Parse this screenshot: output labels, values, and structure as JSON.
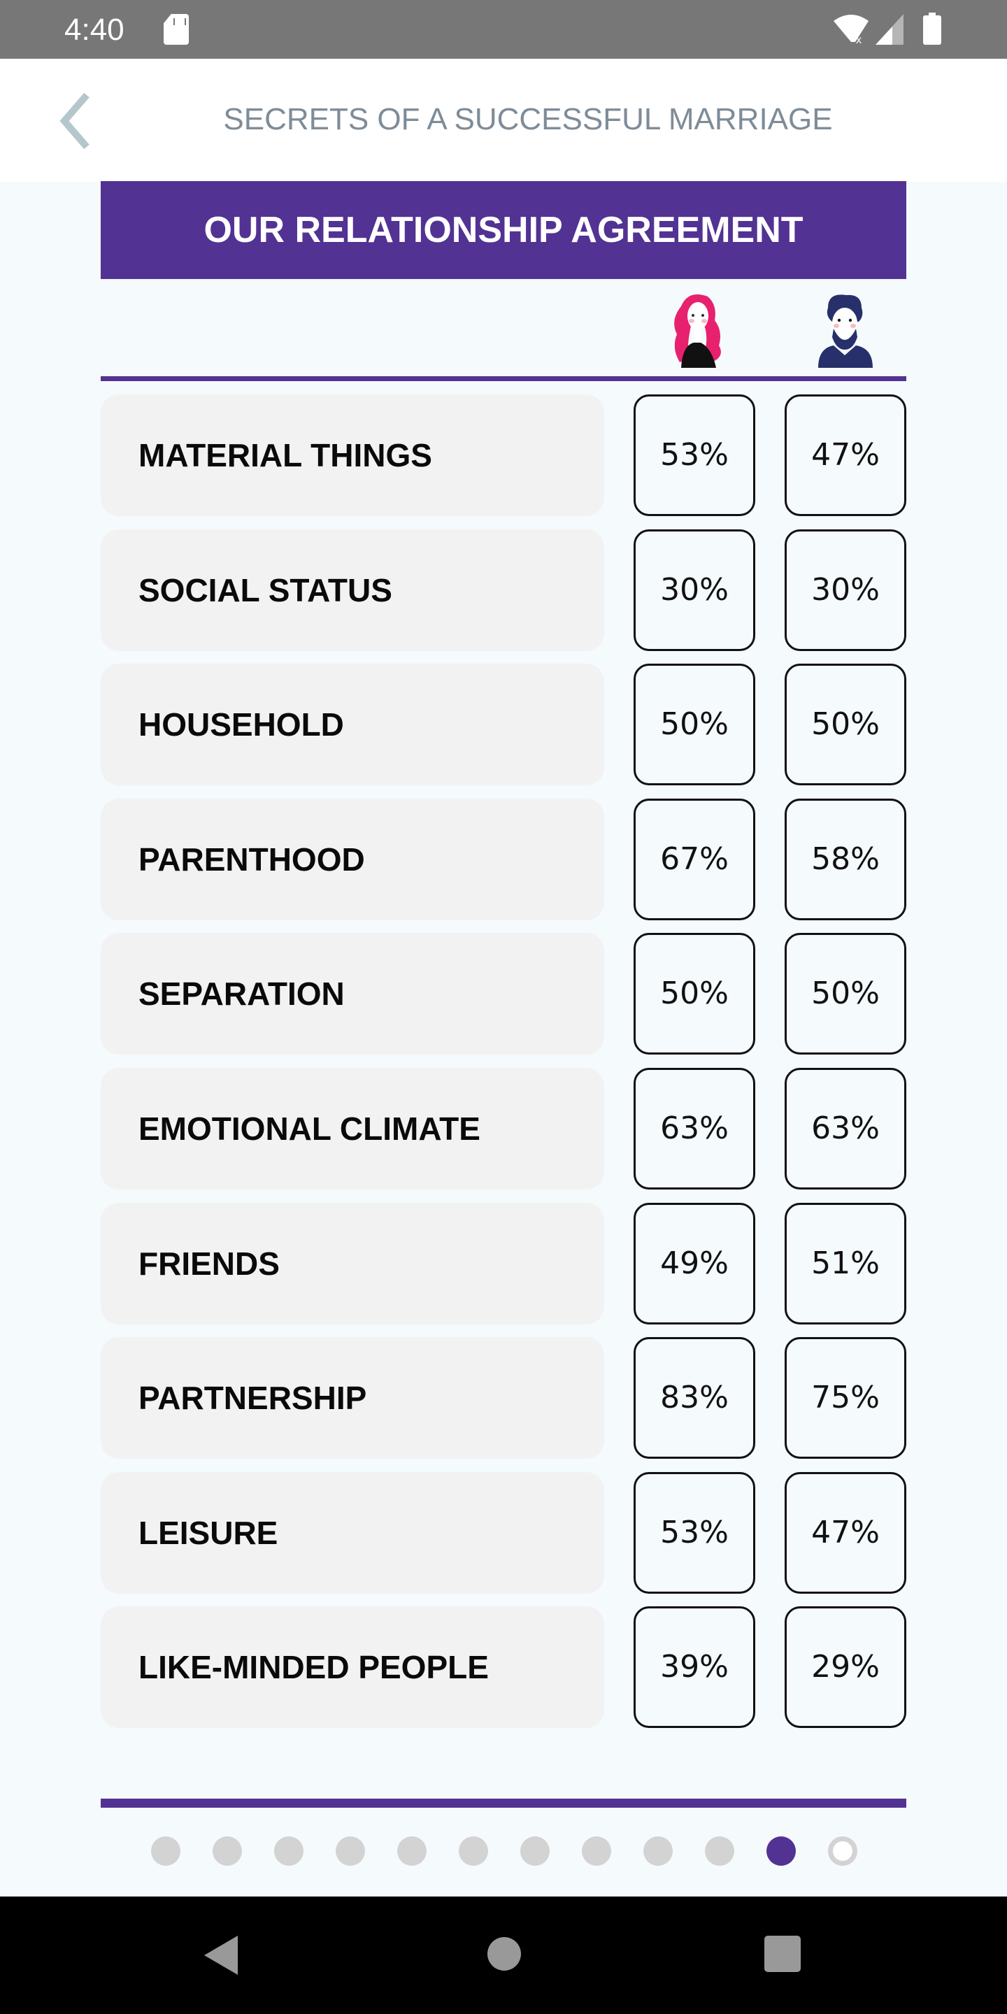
{
  "status_bar": {
    "time": "4:40",
    "icons": [
      "sd-card-icon",
      "wifi-off-icon",
      "signal-icon",
      "battery-icon"
    ]
  },
  "app_bar": {
    "back_icon": "chevron-left-icon",
    "title": "SECRETS OF A SUCCESSFUL MARRIAGE"
  },
  "banner": {
    "title": "OUR RELATIONSHIP AGREEMENT"
  },
  "columns": {
    "her_icon": "woman-avatar-icon",
    "him_icon": "man-avatar-icon"
  },
  "rows": [
    {
      "label": "MATERIAL THINGS",
      "her": "53%",
      "him": "47%"
    },
    {
      "label": "SOCIAL STATUS",
      "her": "30%",
      "him": "30%"
    },
    {
      "label": "HOUSEHOLD",
      "her": "50%",
      "him": "50%"
    },
    {
      "label": "PARENTHOOD",
      "her": "67%",
      "him": "58%"
    },
    {
      "label": "SEPARATION",
      "her": "50%",
      "him": "50%"
    },
    {
      "label": "EMOTIONAL CLIMATE",
      "her": "63%",
      "him": "63%"
    },
    {
      "label": "FRIENDS",
      "her": "49%",
      "him": "51%"
    },
    {
      "label": "PARTNERSHIP",
      "her": "83%",
      "him": "75%"
    },
    {
      "label": "LEISURE",
      "her": "53%",
      "him": "47%"
    },
    {
      "label": "LIKE-MINDED PEOPLE",
      "her": "39%",
      "him": "29%"
    }
  ],
  "pager": {
    "total": 12,
    "current_index": 10,
    "accent": "#523293",
    "inactive": "#d3d3d3"
  },
  "colors": {
    "accent": "#523293",
    "background": "#f5fafd",
    "row_bg": "#f2f2f2"
  },
  "nav_bar": {
    "buttons": [
      "back",
      "home",
      "recents"
    ]
  }
}
